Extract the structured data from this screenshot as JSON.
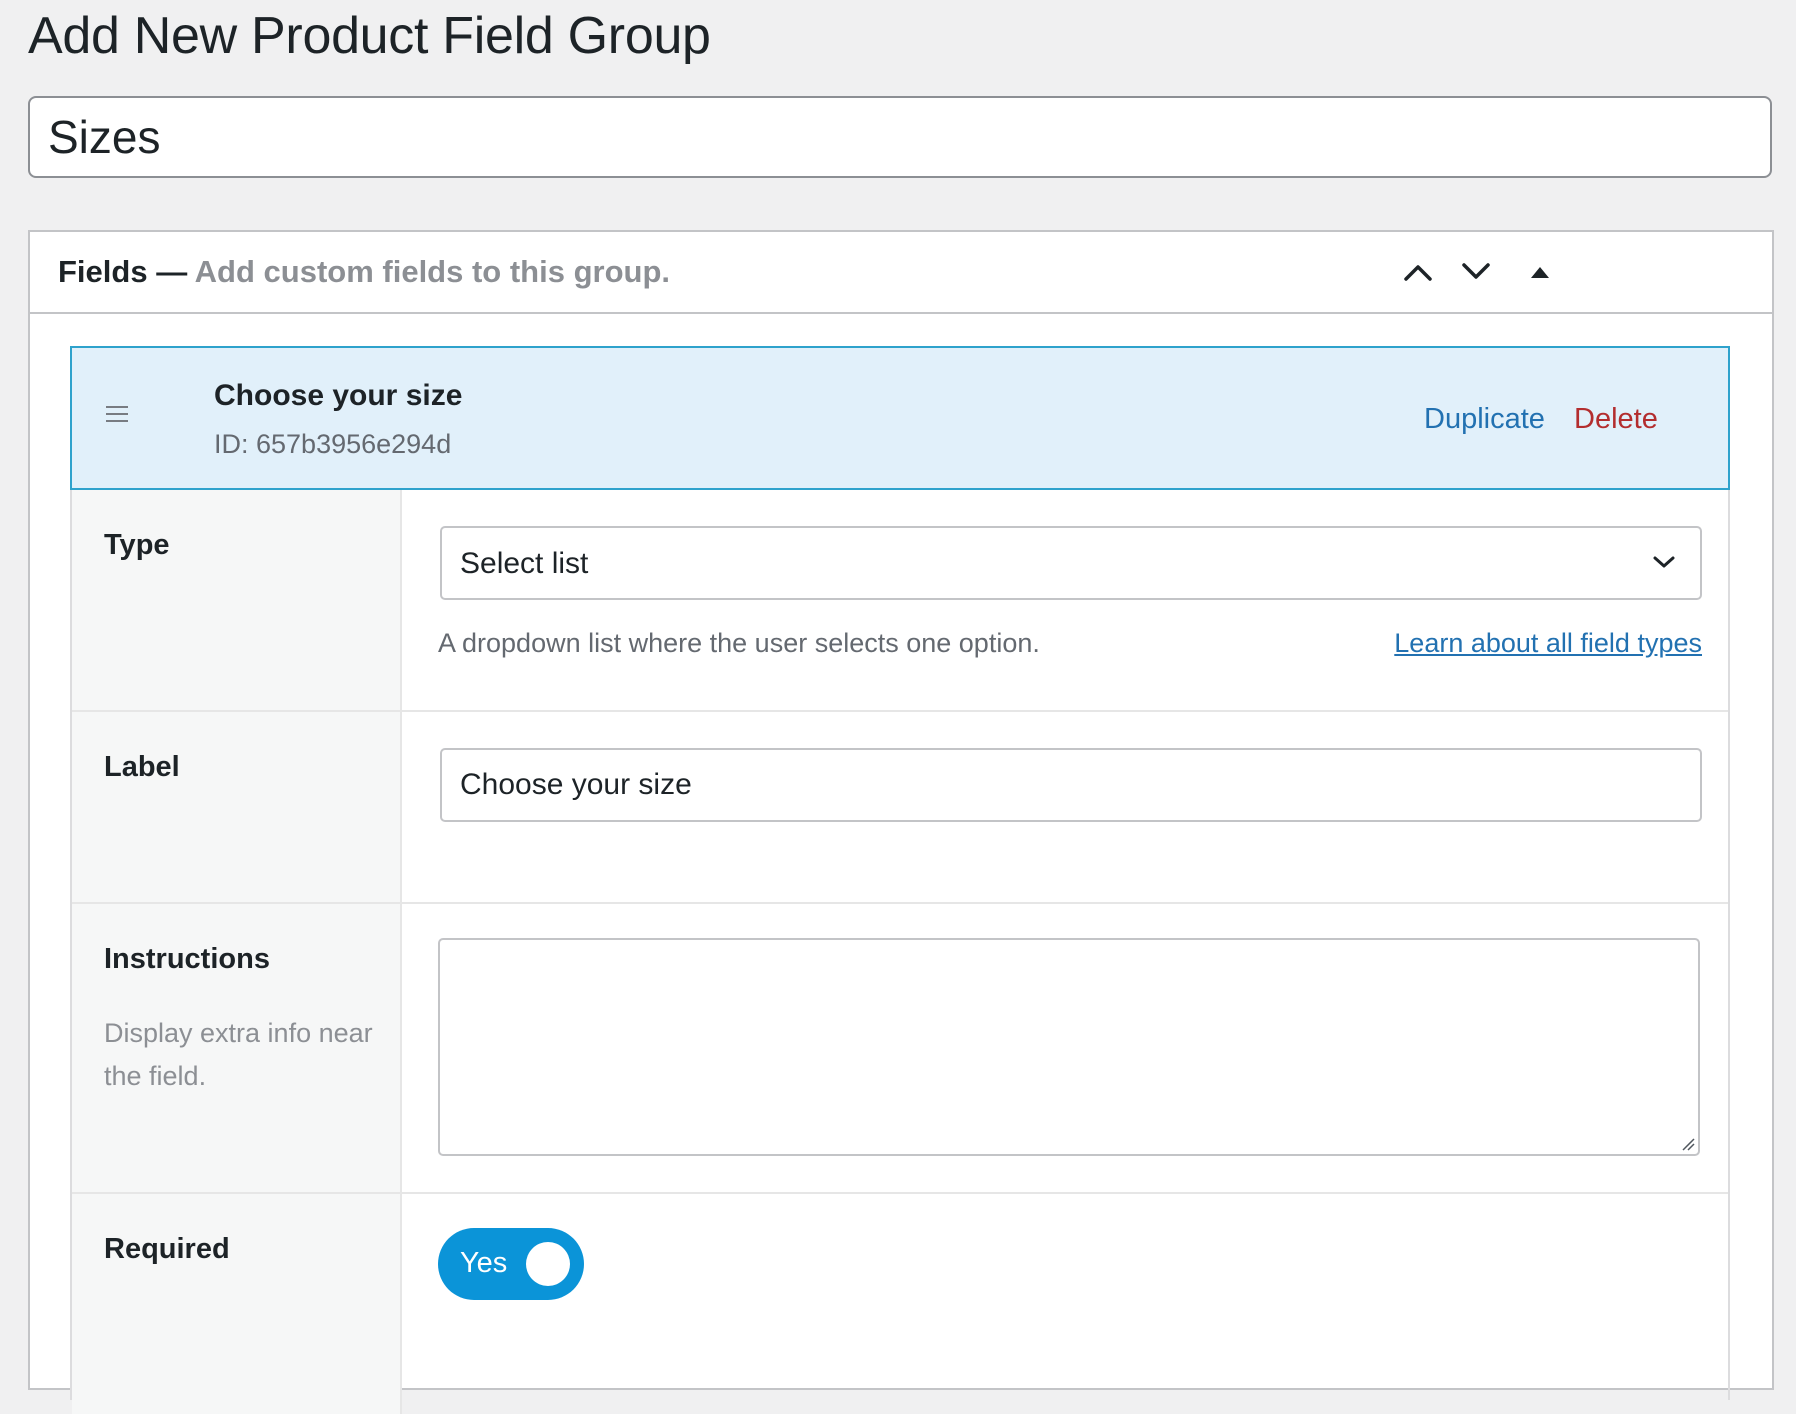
{
  "page": {
    "title": "Add New Product Field Group",
    "group_title_value": "Sizes"
  },
  "fields_box": {
    "title": "Fields —",
    "description": "Add custom fields to this group.",
    "icons": [
      "chevron-up-icon",
      "chevron-down-icon",
      "collapse-triangle-icon"
    ]
  },
  "field": {
    "name": "Choose your size",
    "id_text": "ID: 657b3956e294d",
    "duplicate_label": "Duplicate",
    "delete_label": "Delete"
  },
  "settings": {
    "type": {
      "label": "Type",
      "selected": "Select list",
      "description": "A dropdown list where the user selects one option.",
      "link": "Learn about all field types"
    },
    "label": {
      "label": "Label",
      "value": "Choose your size"
    },
    "instructions": {
      "label": "Instructions",
      "hint": "Display extra info near the field.",
      "value": ""
    },
    "required": {
      "label": "Required",
      "toggle_text": "Yes",
      "checked": true
    }
  },
  "colors": {
    "link": "#2271b1",
    "delete": "#b32d2e",
    "toggle_on": "#0b94d8",
    "field_head_bg": "#e1f0fa",
    "field_head_border": "#2ea2cc"
  }
}
